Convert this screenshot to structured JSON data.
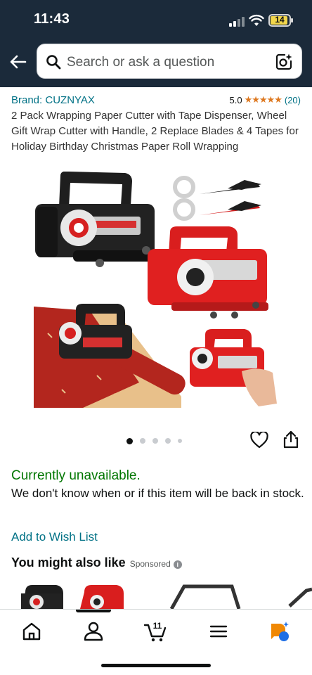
{
  "status_bar": {
    "time": "11:43",
    "battery": "14"
  },
  "header": {
    "search_placeholder": "Search or ask a question"
  },
  "product": {
    "brand": "Brand: CUZNYAX",
    "rating_score": "5.0",
    "rating_stars": "★★★★★",
    "rating_count": "(20)",
    "title": "2 Pack Wrapping Paper Cutter with Tape Dispenser, Wheel Gift Wrap Cutter with Handle, 2 Replace Blades & 4 Tapes for Holiday Birthday Christmas Paper Roll Wrapping",
    "image_count": 5,
    "active_image_index": 0
  },
  "availability": {
    "status": "Currently unavailable.",
    "message": "We don't know when or if this item will be back in stock."
  },
  "actions": {
    "add_to_wish_list": "Add to Wish List"
  },
  "recommendations": {
    "heading": "You might also like",
    "sponsored": "Sponsored",
    "info_icon": "i"
  },
  "bottom_nav": {
    "items": [
      "home-icon",
      "account-icon",
      "cart-icon",
      "menu-icon",
      "rufus-icon"
    ],
    "cart_count": "11",
    "active_index": 1
  },
  "colors": {
    "header_bg": "#1b2a3a",
    "link": "#007185",
    "available_green": "#007600",
    "star": "#de7921",
    "text": "#0f1111"
  }
}
